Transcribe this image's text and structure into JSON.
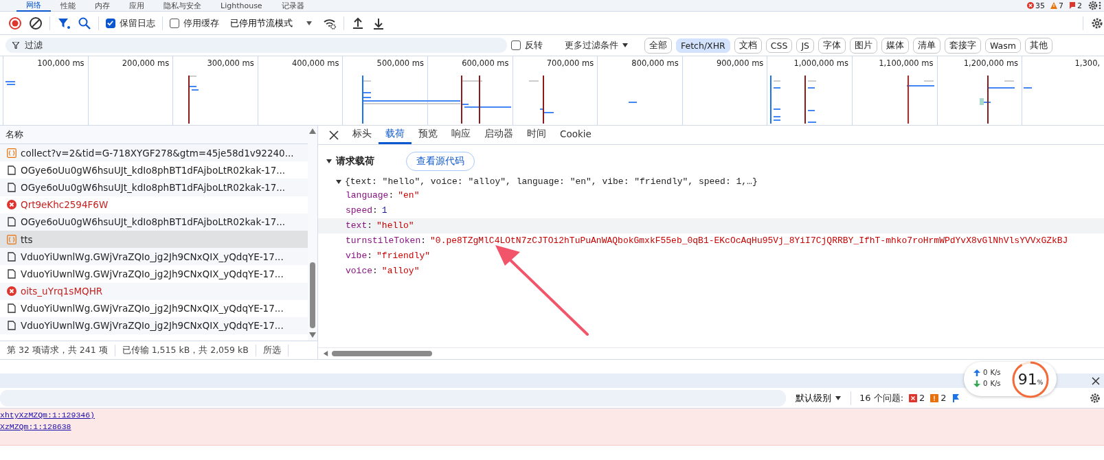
{
  "panel_tabs": [
    {
      "label": "网络",
      "selected": true
    },
    {
      "label": "性能",
      "selected": false
    },
    {
      "label": "内存",
      "selected": false
    },
    {
      "label": "应用",
      "selected": false
    },
    {
      "label": "隐私与安全",
      "selected": false
    },
    {
      "label": "Lighthouse",
      "selected": false
    },
    {
      "label": "记录器",
      "selected": false
    }
  ],
  "issue_counts": [
    {
      "kind": "error",
      "count": "35"
    },
    {
      "kind": "warning",
      "count": "7"
    },
    {
      "kind": "info",
      "count": "2"
    }
  ],
  "toolbar": {
    "preserve_log": {
      "label": "保留日志",
      "checked": true
    },
    "disable_cache": {
      "label": "停用缓存",
      "checked": false
    },
    "throttling": "已停用节流模式"
  },
  "filter": {
    "placeholder": "过滤",
    "invert": {
      "label": "反转",
      "checked": false
    },
    "more_filters": "更多过滤条件",
    "types": [
      {
        "label": "全部",
        "selected": false
      },
      {
        "label": "Fetch/XHR",
        "selected": true
      },
      {
        "label": "文档",
        "selected": false
      },
      {
        "label": "CSS",
        "selected": false
      },
      {
        "label": "JS",
        "selected": false
      },
      {
        "label": "字体",
        "selected": false
      },
      {
        "label": "图片",
        "selected": false
      },
      {
        "label": "媒体",
        "selected": false
      },
      {
        "label": "清单",
        "selected": false
      },
      {
        "label": "套接字",
        "selected": false
      },
      {
        "label": "Wasm",
        "selected": false
      },
      {
        "label": "其他",
        "selected": false
      }
    ]
  },
  "timeline": {
    "ticks": [
      "100,000 ms",
      "200,000 ms",
      "300,000 ms",
      "400,000 ms",
      "500,000 ms",
      "600,000 ms",
      "700,000 ms",
      "800,000 ms",
      "900,000 ms",
      "1,000,000 ms",
      "1,100,000 ms",
      "1,200,000 ms",
      "1,300,"
    ]
  },
  "requests": {
    "column": "名称",
    "rows": [
      {
        "name": "collect?v=2&tid=G-718XYGF278&gtm=45je58d1v92240...",
        "kind": "fetch",
        "selected": false
      },
      {
        "name": "OGye6oUu0gW6hsuUJt_kdIo8phBT1dFAjboLtR02kak-17...",
        "kind": "document",
        "selected": false
      },
      {
        "name": "OGye6oUu0gW6hsuUJt_kdIo8phBT1dFAjboLtR02kak-17...",
        "kind": "document",
        "selected": false
      },
      {
        "name": "Qrt9eKhc2594F6W",
        "kind": "error",
        "selected": false
      },
      {
        "name": "OGye6oUu0gW6hsuUJt_kdIo8phBT1dFAjboLtR02kak-17...",
        "kind": "document",
        "selected": false
      },
      {
        "name": "tts",
        "kind": "fetch",
        "selected": true
      },
      {
        "name": "VduoYiUwnlWg.GWjVraZQIo_jg2Jh9CNxQIX_yQdqYE-17...",
        "kind": "document",
        "selected": false
      },
      {
        "name": "VduoYiUwnlWg.GWjVraZQIo_jg2Jh9CNxQIX_yQdqYE-17...",
        "kind": "document",
        "selected": false
      },
      {
        "name": "oits_uYrq1sMQHR",
        "kind": "error",
        "selected": false
      },
      {
        "name": "VduoYiUwnlWg.GWjVraZQIo_jg2Jh9CNxQIX_yQdqYE-17...",
        "kind": "document",
        "selected": false
      },
      {
        "name": "VduoYiUwnlWg.GWjVraZQIo_jg2Jh9CNxQIX_yQdqYE-17...",
        "kind": "document",
        "selected": false
      }
    ],
    "status": [
      "第 32 项请求，共 241 项",
      "已传输 1,515 kB，共 2,059 kB",
      "所选"
    ]
  },
  "detail_tabs": [
    {
      "label": "标头",
      "selected": false
    },
    {
      "label": "载荷",
      "selected": true
    },
    {
      "label": "预览",
      "selected": false
    },
    {
      "label": "响应",
      "selected": false
    },
    {
      "label": "启动器",
      "selected": false
    },
    {
      "label": "时间",
      "selected": false
    },
    {
      "label": "Cookie",
      "selected": false
    }
  ],
  "payload": {
    "title": "请求载荷",
    "expanded": true,
    "view_source": "查看源代码",
    "summary": "{text: \"hello\", voice: \"alloy\", language: \"en\", vibe: \"friendly\", speed: 1,…}",
    "summary_expanded": true,
    "properties": [
      {
        "key": "language",
        "colon": ":",
        "value": "\"en\"",
        "kind": "string",
        "hovered": false
      },
      {
        "key": "speed",
        "colon": ":",
        "value": "1",
        "kind": "number",
        "hovered": false
      },
      {
        "key": "text",
        "colon": ":",
        "value": "\"hello\"",
        "kind": "string",
        "hovered": true
      },
      {
        "key": "turnstileToken",
        "colon": ":",
        "value": "\"0.pe8TZgMlC4LOtN7zCJTOi2hTuPuAnWAQbokGmxkF55eb_0qB1-EKcOcAqHu95Vj_8YiI7CjQRRBY_IfhT-mhko7roHrmWPdYvX8vGlNhVlsYVVxGZkBJ",
        "kind": "string",
        "hovered": false
      },
      {
        "key": "vibe",
        "colon": ":",
        "value": "\"friendly\"",
        "kind": "string",
        "hovered": false
      },
      {
        "key": "voice",
        "colon": ":",
        "value": "\"alloy\"",
        "kind": "string",
        "hovered": false
      }
    ]
  },
  "console": {
    "level": "默认级别",
    "issues_label": "16 个问题:",
    "issue_counts": [
      {
        "kind": "error",
        "count": "2"
      },
      {
        "kind": "warning",
        "count": "2"
      }
    ],
    "messages": [
      "xhtyXzMZQm:1:129346)",
      "XzMZQm:1:128638"
    ]
  },
  "speed_widget": {
    "upload": "0",
    "download": "0",
    "upload_unit": "K/s",
    "download_unit": "K/s",
    "percent": "91",
    "percent_sign": "%",
    "level": 0.91
  }
}
